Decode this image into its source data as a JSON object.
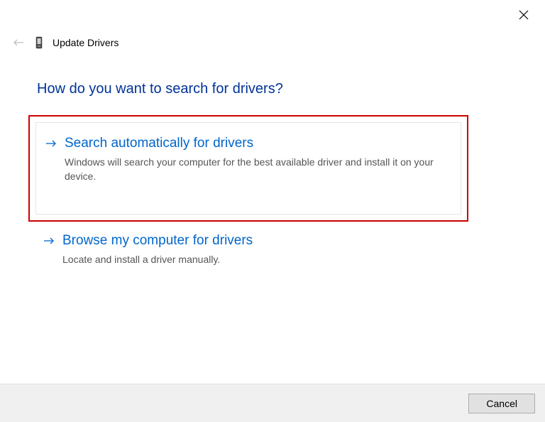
{
  "header": {
    "title": "Update Drivers"
  },
  "main": {
    "heading": "How do you want to search for drivers?"
  },
  "options": [
    {
      "title": "Search automatically for drivers",
      "description": "Windows will search your computer for the best available driver and install it on your device."
    },
    {
      "title": "Browse my computer for drivers",
      "description": "Locate and install a driver manually."
    }
  ],
  "footer": {
    "cancel_label": "Cancel"
  }
}
